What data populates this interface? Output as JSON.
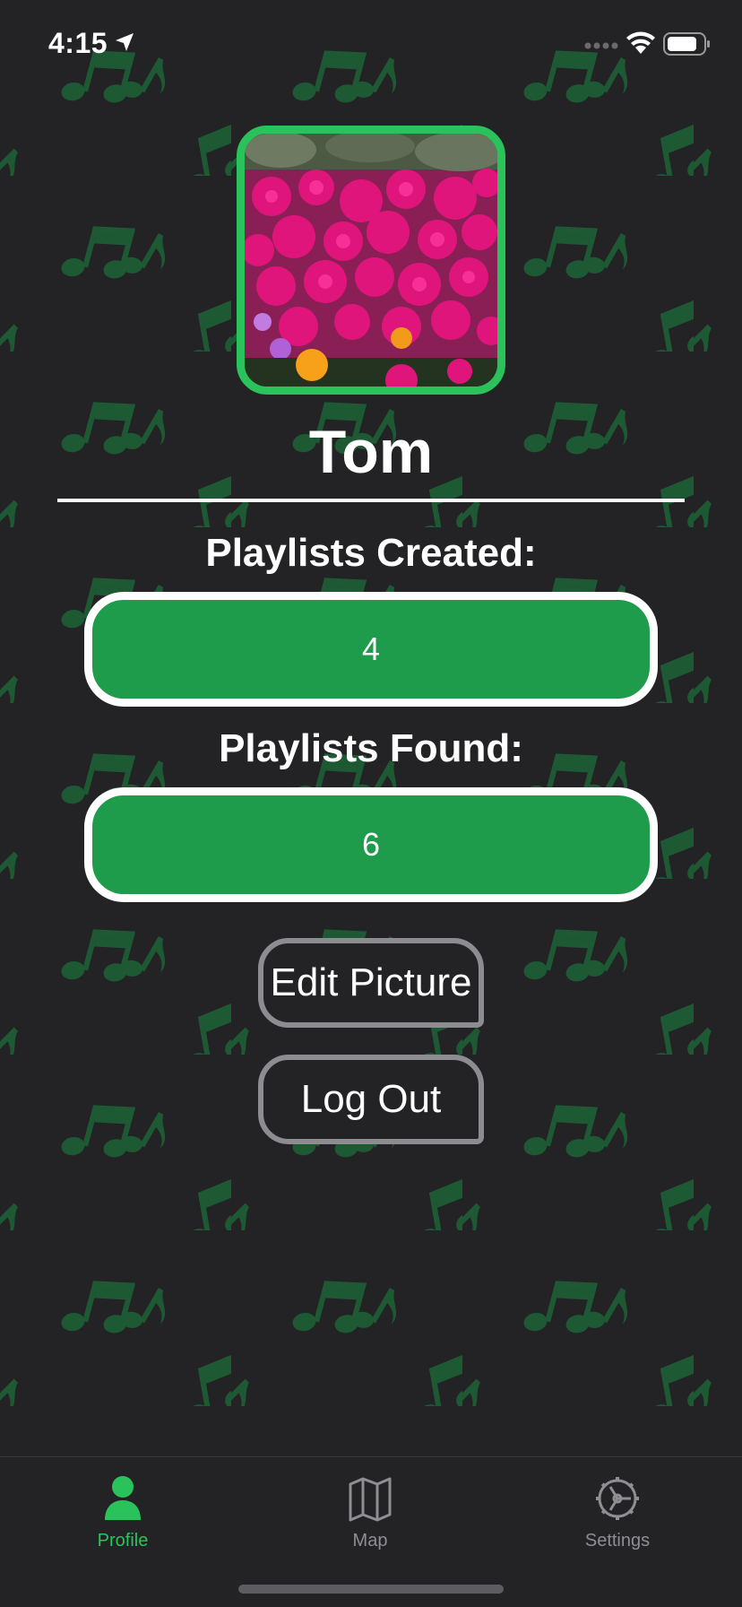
{
  "status_bar": {
    "time": "4:15",
    "location_icon": "location-arrow-icon",
    "signal_icon": "cellular-signal-icon",
    "wifi_icon": "wifi-icon",
    "battery_icon": "battery-icon"
  },
  "background": {
    "icon": "music-note-icon",
    "color": "#232325",
    "pattern_color": "#1d5a33"
  },
  "profile": {
    "avatar_icon": "profile-photo",
    "avatar_border_color": "#2ac35b",
    "name": "Tom"
  },
  "stats": {
    "created_label": "Playlists Created:",
    "created_value": "4",
    "found_label": "Playlists Found:",
    "found_value": "6",
    "box_color": "#1f9c4b"
  },
  "actions": {
    "edit_picture_label": "Edit Picture",
    "log_out_label": "Log Out"
  },
  "tab_bar": {
    "active_color": "#2ac35b",
    "inactive_color": "#8e8e93",
    "tabs": [
      {
        "label": "Profile",
        "icon": "person-icon",
        "active": true
      },
      {
        "label": "Map",
        "icon": "map-icon",
        "active": false
      },
      {
        "label": "Settings",
        "icon": "gear-icon",
        "active": false
      }
    ]
  }
}
